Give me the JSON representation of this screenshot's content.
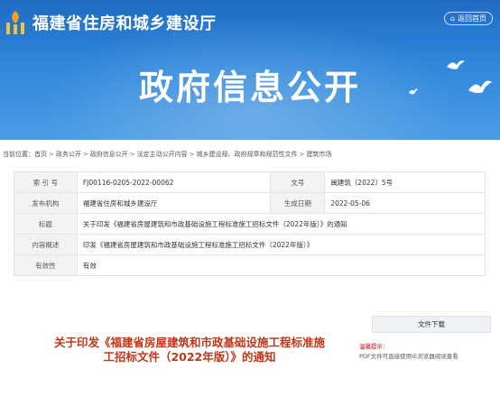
{
  "header": {
    "site_title": "福建省住房和城乡建设厅",
    "home_link": "返回首页",
    "banner_title": "政府信息公开"
  },
  "breadcrumb": {
    "prefix": "当前位置：",
    "items": [
      "首页",
      "政务公开",
      "政府信息公开",
      "法定主动公开内容",
      "城乡建设规、政府规章和规范性文件",
      "建筑市场"
    ]
  },
  "info_table": {
    "index_no_label": "索 引 号",
    "index_no": "FJ00116-0205-2022-00062",
    "doc_no_label": "文号",
    "doc_no": "闽建筑〔2022〕5号",
    "issuer_label": "发布机构",
    "issuer": "福建省住房和城乡建设厅",
    "date_label": "生成日期",
    "date": "2022-05-06",
    "title_label": "标题",
    "title": "关于印发《福建省房屋建筑和市政基础设施工程标准施工招标文件（2022年版）》的通知",
    "summary_label": "内容概述",
    "summary": "印发《福建省房屋建筑和市政基础设施工程标准施工招标文件（2022年版）》",
    "validity_label": "有效性",
    "validity": "有效"
  },
  "article": {
    "title": "关于印发《福建省房屋建筑和市政基础设施工程标准施工招标文件（2022年版）》的通知"
  },
  "download": {
    "button": "文件下载",
    "tip_label": "温馨提示：",
    "tip_text": "PDF文件可直接使用IE浏览器阅读查看"
  },
  "colors": {
    "banner": "#2a7fd6",
    "title_red": "#c03616",
    "tip_red": "#d0021b"
  }
}
